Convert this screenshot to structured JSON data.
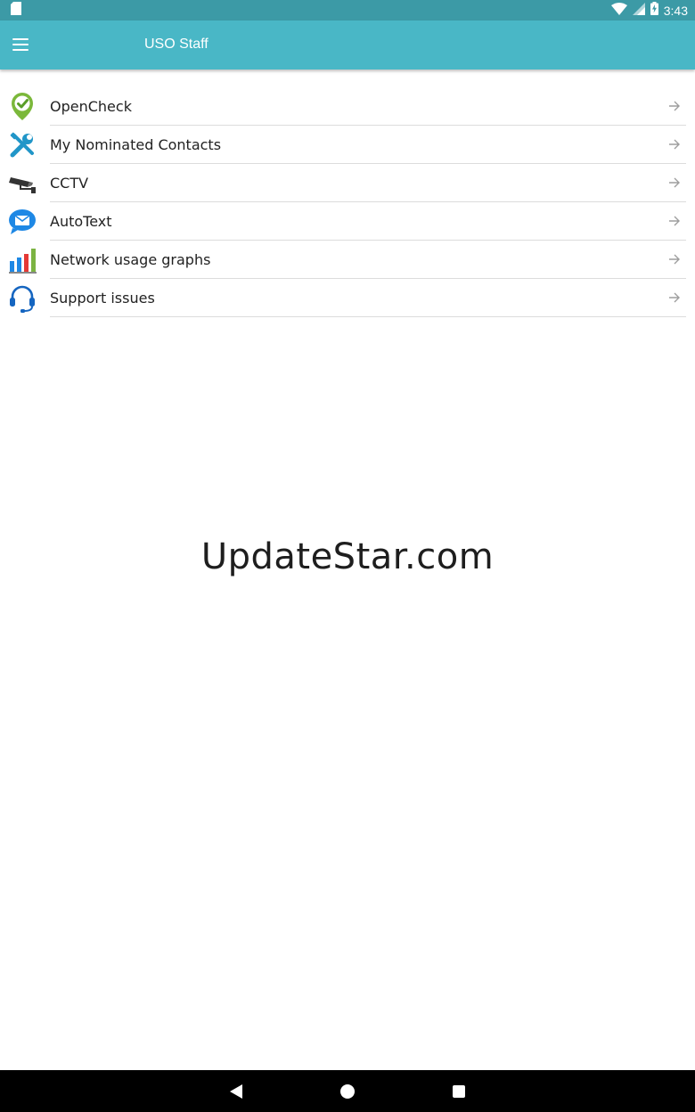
{
  "status_bar": {
    "time": "3:43",
    "icons": [
      "sd-card-icon",
      "wifi-icon",
      "signal-icon",
      "battery-charging-icon"
    ]
  },
  "app_bar": {
    "title": "USO Staff",
    "menu_icon": "hamburger-menu-icon",
    "color": "#49b7c6"
  },
  "menu": {
    "items": [
      {
        "label": "OpenCheck",
        "icon": "check-shield-icon"
      },
      {
        "label": "My Nominated Contacts",
        "icon": "tools-icon"
      },
      {
        "label": "CCTV",
        "icon": "cctv-camera-icon"
      },
      {
        "label": "AutoText",
        "icon": "message-envelope-icon"
      },
      {
        "label": "Network usage graphs",
        "icon": "bar-chart-icon"
      },
      {
        "label": "Support issues",
        "icon": "headset-icon"
      }
    ]
  },
  "watermark": "UpdateStar.com",
  "nav_bar": {
    "buttons": [
      "back",
      "home",
      "recents"
    ]
  }
}
